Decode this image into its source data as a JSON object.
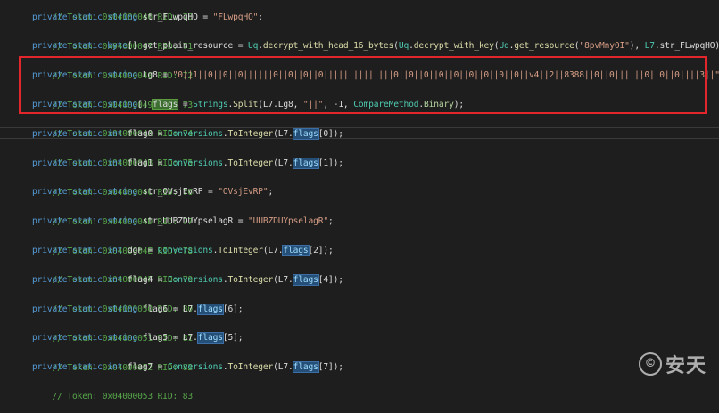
{
  "watermark": {
    "logo_icon": "copyright-swoosh-icon",
    "text": "安天"
  },
  "code": {
    "l1": {
      "c": "// Token: 0x04000046 RID: 70"
    },
    "l2": {
      "k1": "private static",
      "t": "string",
      "n": "str_FLwpqHO",
      "eq": " = ",
      "s": "\"FLwpqHO\"",
      "end": ";"
    },
    "l3": {
      "c": "// Token: 0x04000047 RID: 71"
    },
    "l4": {
      "k1": "private static",
      "t": "byte",
      "br": "[] ",
      "n": "get_plain_resource",
      "eq": " = ",
      "c1": "Uq",
      "d1": ".",
      "f1": "decrypt_with_head_16_bytes",
      "p1": "(",
      "c2": "Uq",
      "d2": ".",
      "f2": "decrypt_with_key",
      "p2": "(",
      "c3": "Uq",
      "d3": ".",
      "f3": "get_resource",
      "p3": "(",
      "s": "\"8pvMny0I\"",
      "cm": "), ",
      "c4": "L7",
      "tail": ".str_FLwpqHO));"
    },
    "l5": {
      "c": "// Token: 0x04000048 RID: 72"
    },
    "l6": {
      "k1": "private static",
      "t": "string",
      "n": "Lg8",
      "eq": " = ",
      "s": "\"0||1||0||0||0||||||0||0||0||0||||||||||||||0||0||0||0||0||0||0||0||0||v4||2||8388||0||0||||||0||0||0||||3||\"",
      "end": ";"
    },
    "l7": {
      "c": "// Token: 0x04000049 RID: 73"
    },
    "l8": {
      "k1": "private static",
      "t": "string",
      "br": "[] ",
      "fl": "flags",
      "eq": " = ",
      "c1": "Strings",
      "d1": ".",
      "f1": "Split",
      "p1": "(L7.Lg8, ",
      "s": "\"||\"",
      "mid": ", -1, ",
      "e1": "CompareMethod",
      "d2": ".",
      "e2": "Binary",
      "end": ");"
    },
    "l9": {
      "c": "// Token: 0x0400004A RID: 74"
    },
    "l10": {
      "k1": "private static",
      "t": "int",
      "n": "flag0",
      "eq": " = ",
      "c1": "Conversions",
      "d1": ".",
      "f1": "ToInteger",
      "p1": "(L7.",
      "fl": "flags",
      "end": "[0]);"
    },
    "l11": {
      "c": "// Token: 0x0400004B RID: 75"
    },
    "l12": {
      "k1": "private static",
      "t": "int",
      "n": "flag1",
      "eq": " = ",
      "c1": "Conversions",
      "d1": ".",
      "f1": "ToInteger",
      "p1": "(L7.",
      "fl": "flags",
      "end": "[1]);"
    },
    "l13": {
      "c": "// Token: 0x0400004C RID: 76"
    },
    "l14": {
      "k1": "private static",
      "t": "string",
      "n": "str_OVsjEvRP",
      "eq": " = ",
      "s": "\"OVsjEvRP\"",
      "end": ";"
    },
    "l15": {
      "c": "// Token: 0x0400004D RID: 77"
    },
    "l16": {
      "k1": "private static",
      "t": "string",
      "n": "str_UUBZDUYpselagR",
      "eq": " = ",
      "s": "\"UUBZDUYpselagR\"",
      "end": ";"
    },
    "l17": {
      "c": "// Token: 0x0400004E RID: 78"
    },
    "l18": {
      "k1": "private static",
      "t": "int",
      "n": "dgF",
      "eq": " = ",
      "c1": "Conversions",
      "d1": ".",
      "f1": "ToInteger",
      "p1": "(L7.",
      "fl": "flags",
      "end": "[2]);"
    },
    "l19": {
      "c": "// Token: 0x0400004F RID: 79"
    },
    "l20": {
      "k1": "private static",
      "t": "int",
      "n": "flag4",
      "eq": " = ",
      "c1": "Conversions",
      "d1": ".",
      "f1": "ToInteger",
      "p1": "(L7.",
      "fl": "flags",
      "end": "[4]);"
    },
    "l21": {
      "c": "// Token: 0x04000050 RID: 80"
    },
    "l22": {
      "k1": "private static",
      "t": "string",
      "n": "flag6",
      "eq": " = ",
      "p1": "L7.",
      "fl": "flags",
      "end": "[6];"
    },
    "l23": {
      "c": "// Token: 0x04000051 RID: 81"
    },
    "l24": {
      "k1": "private static",
      "t": "string",
      "n": "flag5",
      "eq": " = ",
      "p1": "L7.",
      "fl": "flags",
      "end": "[5];"
    },
    "l25": {
      "c": "// Token: 0x04000052 RID: 82"
    },
    "l26": {
      "k1": "private static",
      "t": "int",
      "n": "flag7",
      "eq": " = ",
      "c1": "Conversions",
      "d1": ".",
      "f1": "ToInteger",
      "p1": "(L7.",
      "fl": "flags",
      "end": "[7]);"
    },
    "l27": {
      "c": "// Token: 0x04000053 RID: 83"
    }
  }
}
